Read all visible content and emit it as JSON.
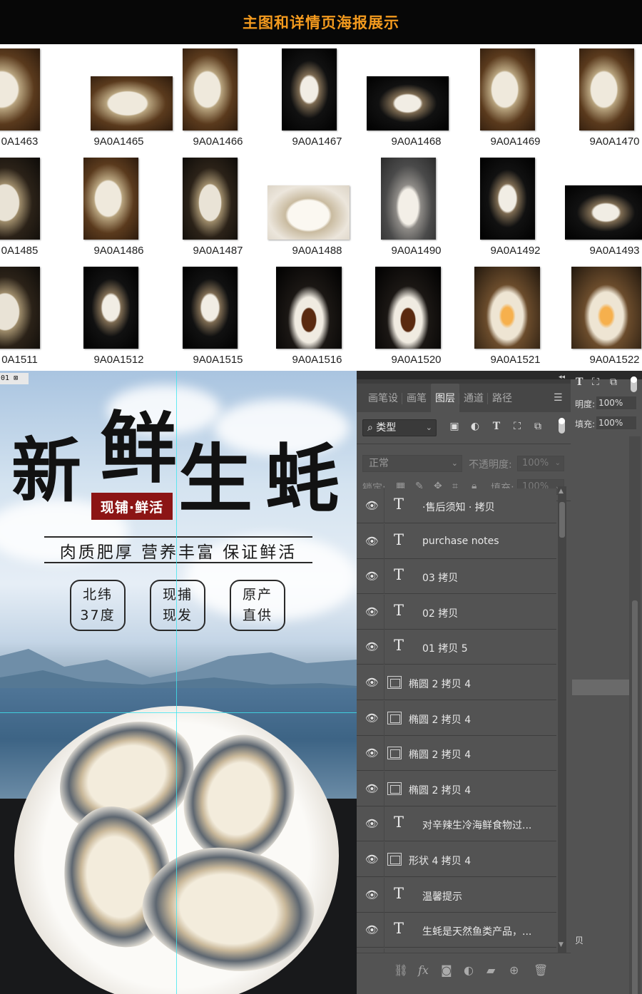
{
  "banner": {
    "title": "主图和详情页海报展示"
  },
  "thumbnails": [
    {
      "caption": "0A1463"
    },
    {
      "caption": "9A0A1465"
    },
    {
      "caption": "9A0A1466"
    },
    {
      "caption": "9A0A1467"
    },
    {
      "caption": "9A0A1468"
    },
    {
      "caption": "9A0A1469"
    },
    {
      "caption": "9A0A1470"
    },
    {
      "caption": "0A1485"
    },
    {
      "caption": "9A0A1486"
    },
    {
      "caption": "9A0A1487"
    },
    {
      "caption": "9A0A1488"
    },
    {
      "caption": "9A0A1490"
    },
    {
      "caption": "9A0A1492"
    },
    {
      "caption": "9A0A1493"
    },
    {
      "caption": "0A1511"
    },
    {
      "caption": "9A0A1512"
    },
    {
      "caption": "9A0A1515"
    },
    {
      "caption": "9A0A1516"
    },
    {
      "caption": "9A0A1520"
    },
    {
      "caption": "9A0A1521"
    },
    {
      "caption": "9A0A1522"
    }
  ],
  "poster": {
    "doc_tab": "01",
    "title_chars": [
      "新",
      "鲜",
      "生",
      "蚝"
    ],
    "tag": "现铺·鲜活",
    "slogan": "肉质肥厚 营养丰富 保证鲜活",
    "pills": [
      {
        "line1": "北纬",
        "line2": "37度"
      },
      {
        "line1": "现捕",
        "line2": "现发"
      },
      {
        "line1": "原产",
        "line2": "直供"
      }
    ]
  },
  "ps": {
    "tabs": [
      "画笔设",
      "画笔",
      "图层",
      "通道",
      "路径"
    ],
    "active_tab": "图层",
    "filter_kind": "类型",
    "blend_mode": "正常",
    "opacity_label": "不透明度:",
    "opacity_value": "100%",
    "lock_label": "锁定:",
    "fill_label": "填充:",
    "fill_value": "100%",
    "layers": [
      {
        "type": "text",
        "name": "·售后须知 · 拷贝"
      },
      {
        "type": "text",
        "name": "purchase notes"
      },
      {
        "type": "text",
        "name": "03 拷贝"
      },
      {
        "type": "text",
        "name": "02 拷贝"
      },
      {
        "type": "text",
        "name": "01 拷贝 5"
      },
      {
        "type": "shape",
        "name": "椭圆 2 拷贝 4"
      },
      {
        "type": "shape",
        "name": "椭圆 2 拷贝 4"
      },
      {
        "type": "shape",
        "name": "椭圆 2 拷贝 4"
      },
      {
        "type": "shape",
        "name": "椭圆 2 拷贝 4"
      },
      {
        "type": "text",
        "name": "对辛辣生冷海鲜食物过..."
      },
      {
        "type": "shape",
        "name": "形状 4 拷贝 4"
      },
      {
        "type": "text",
        "name": "温馨提示"
      },
      {
        "type": "text",
        "name": "生蚝是天然鱼类产品，..."
      },
      {
        "type": "shape",
        "name": "形状 4 拷贝 4"
      }
    ],
    "right": {
      "opacity_label": "明度:",
      "opacity_value": "100%",
      "fill_label": "填充:",
      "fill_value": "100%",
      "partial_char": "贝"
    }
  },
  "colors": {
    "banner_text": "#f39a1e",
    "tag_bg": "#8c1515",
    "guide": "#3ee6f0"
  },
  "icons": [
    "eye-icon",
    "text-layer-icon",
    "shape-layer-icon",
    "search-icon",
    "link-icon",
    "fx-icon",
    "mask-icon",
    "adjustment-icon",
    "folder-icon",
    "new-layer-icon",
    "trash-icon"
  ]
}
